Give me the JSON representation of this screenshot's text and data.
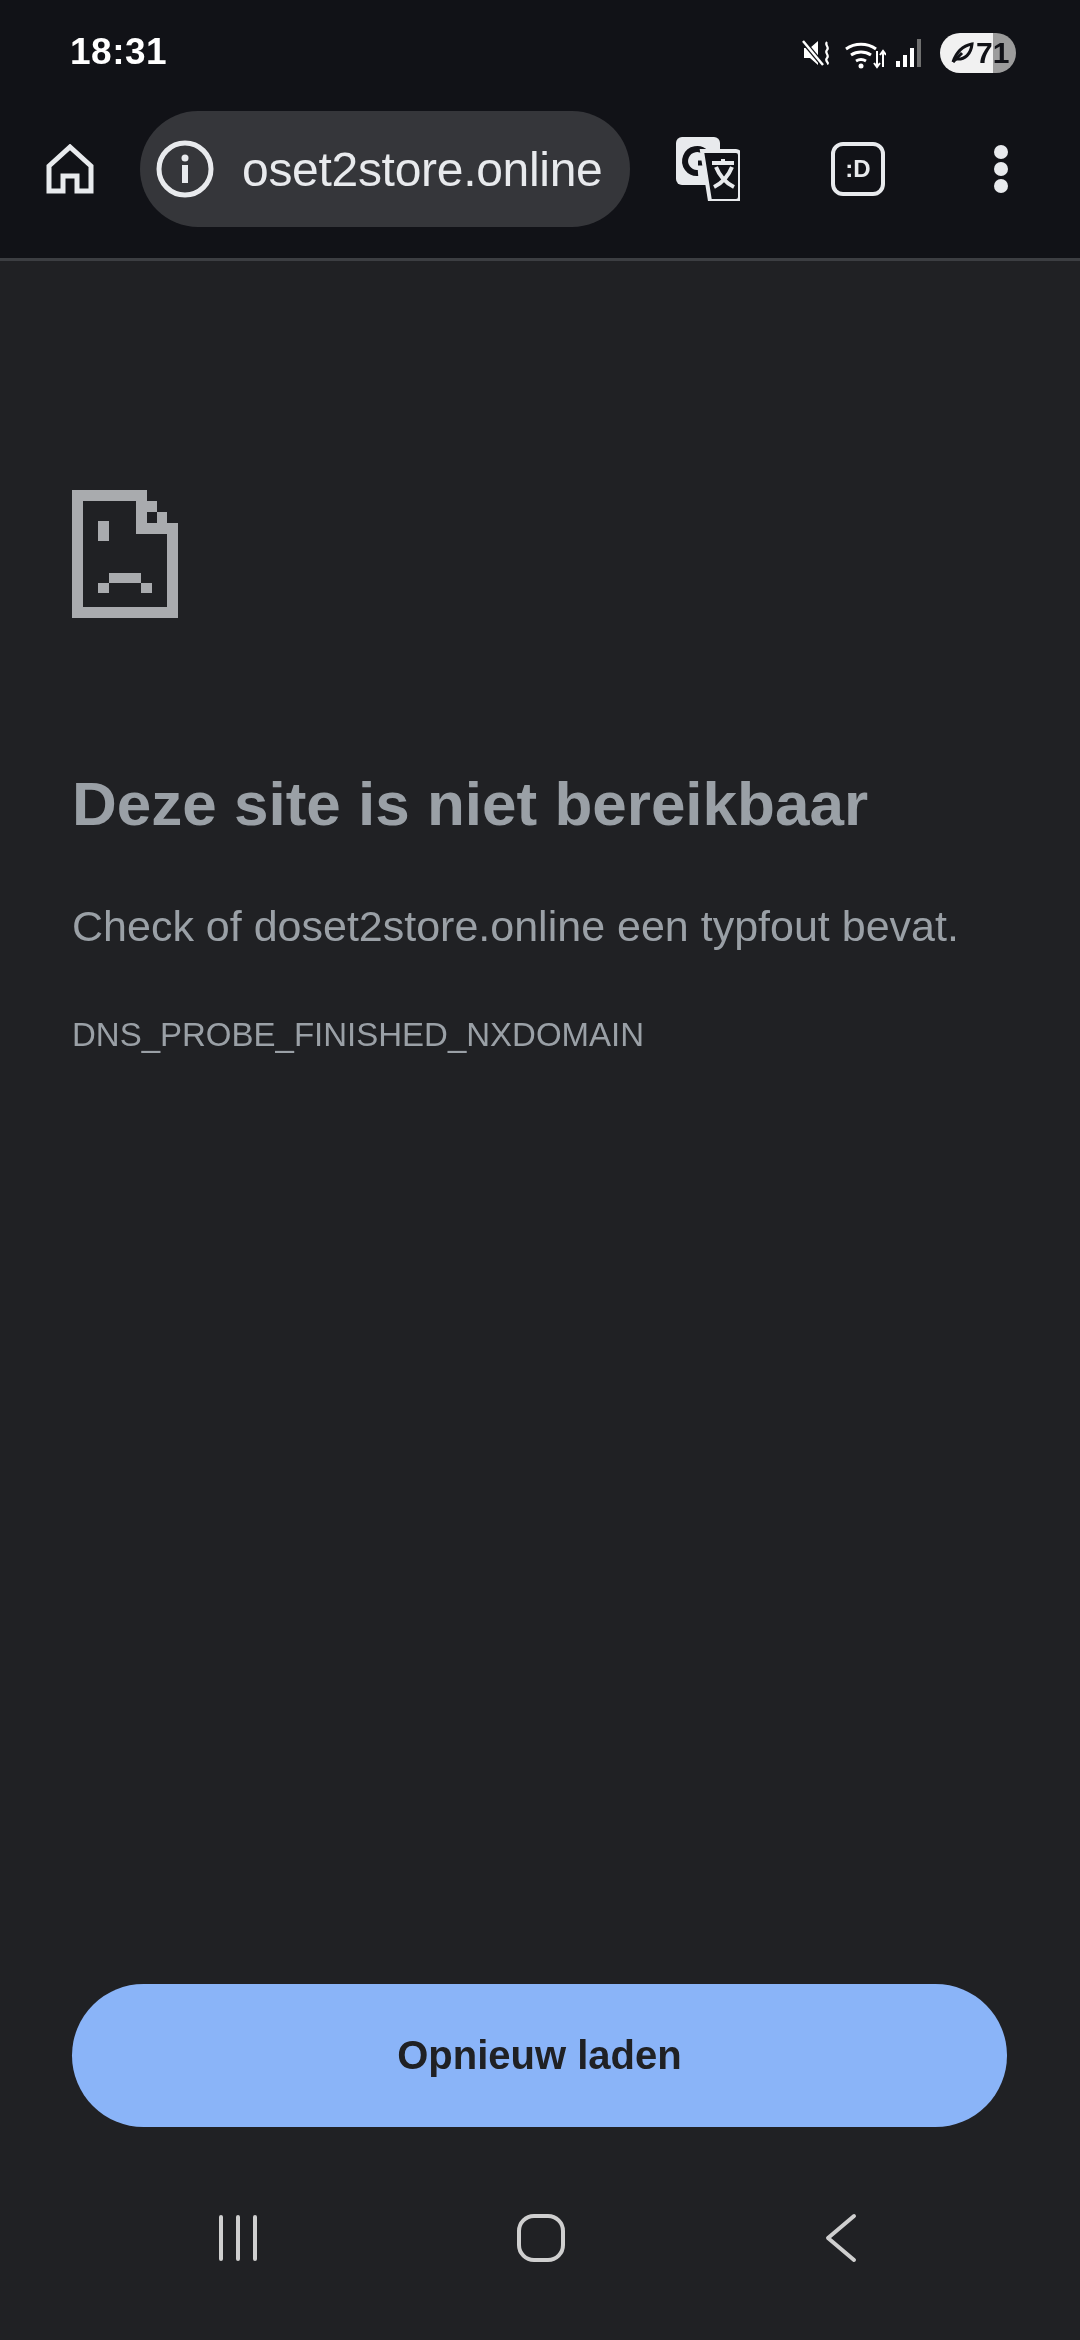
{
  "status_bar": {
    "time": "18:31",
    "battery": "71"
  },
  "toolbar": {
    "url": "oset2store.online",
    "extension_label": ":D"
  },
  "error": {
    "title": "Deze site is niet bereikbaar",
    "message": "Check of doset2store.online een typfout bevat.",
    "code": "DNS_PROBE_FINISHED_NXDOMAIN"
  },
  "reload_button": {
    "label": "Opnieuw laden"
  }
}
